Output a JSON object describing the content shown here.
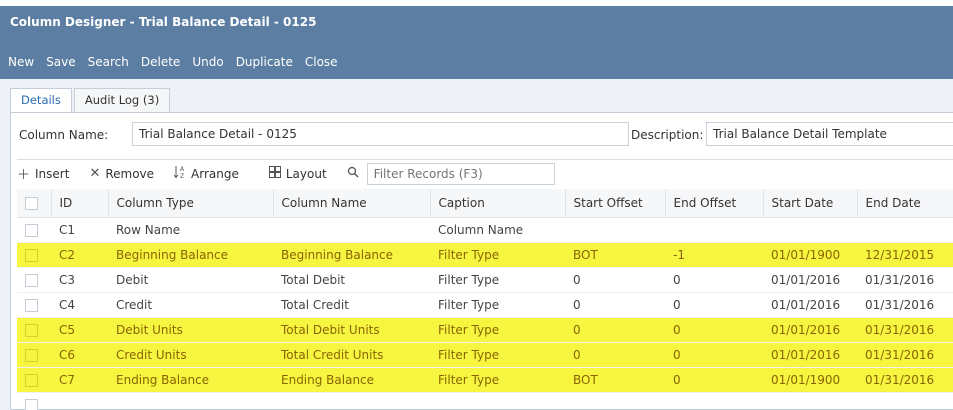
{
  "window": {
    "title": "Column Designer - Trial Balance Detail - 0125"
  },
  "toolbar": {
    "buttons": [
      "New",
      "Save",
      "Search",
      "Delete",
      "Undo",
      "Duplicate",
      "Close"
    ]
  },
  "tabs": [
    "Details",
    "Audit Log (3)"
  ],
  "form": {
    "column_name_label": "Column Name:",
    "column_name_value": "Trial Balance Detail  - 0125",
    "description_label": "Description:",
    "description_value": "Trial Balance Detail Template"
  },
  "grid_toolbar": {
    "insert": "Insert",
    "remove": "Remove",
    "arrange": "Arrange",
    "layout": "Layout",
    "filter_placeholder": "Filter Records (F3)"
  },
  "grid": {
    "headers": [
      "ID",
      "Column Type",
      "Column Name",
      "Caption",
      "Start Offset",
      "End Offset",
      "Start Date",
      "End Date"
    ],
    "rows": [
      {
        "id": "C1",
        "type": "Row Name",
        "name": "",
        "caption": "Column Name",
        "start_offset": "",
        "end_offset": "",
        "start_date": "",
        "end_date": ""
      },
      {
        "id": "C2",
        "type": "Beginning Balance",
        "name": "Beginning Balance",
        "caption": "Filter Type",
        "start_offset": "BOT",
        "end_offset": "-1",
        "start_date": "01/01/1900",
        "end_date": "12/31/2015"
      },
      {
        "id": "C3",
        "type": "Debit",
        "name": "Total Debit",
        "caption": "Filter Type",
        "start_offset": "0",
        "end_offset": "0",
        "start_date": "01/01/2016",
        "end_date": "01/31/2016"
      },
      {
        "id": "C4",
        "type": "Credit",
        "name": "Total Credit",
        "caption": "Filter Type",
        "start_offset": "0",
        "end_offset": "0",
        "start_date": "01/01/2016",
        "end_date": "01/31/2016"
      },
      {
        "id": "C5",
        "type": "Debit Units",
        "name": "Total Debit Units",
        "caption": "Filter Type",
        "start_offset": "0",
        "end_offset": "0",
        "start_date": "01/01/2016",
        "end_date": "01/31/2016"
      },
      {
        "id": "C6",
        "type": "Credit Units",
        "name": "Total Credit Units",
        "caption": "Filter Type",
        "start_offset": "0",
        "end_offset": "0",
        "start_date": "01/01/2016",
        "end_date": "01/31/2016"
      },
      {
        "id": "C7",
        "type": "Ending Balance",
        "name": "Ending Balance",
        "caption": "Filter Type",
        "start_offset": "BOT",
        "end_offset": "0",
        "start_date": "01/01/1900",
        "end_date": "01/31/2016"
      }
    ],
    "highlight_color": "#f6f640"
  },
  "colors": {
    "header_bar": "#5c7ea3",
    "highlight_row": "#f6f640",
    "highlight_text": "#8a6400"
  },
  "icons": {
    "insert": "plus-icon",
    "remove": "x-icon",
    "arrange": "sort-az-icon",
    "layout": "grid-layout-icon",
    "filter": "search-icon"
  }
}
